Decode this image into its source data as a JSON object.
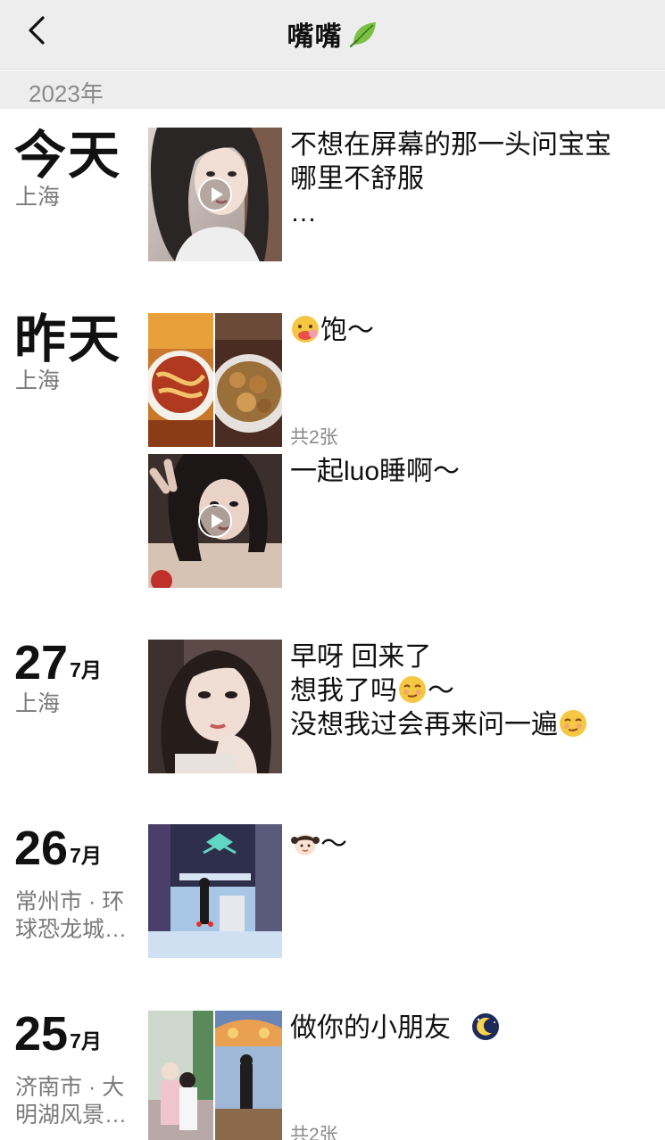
{
  "header": {
    "title": "嘴嘴",
    "title_icon": "leaf-emoji"
  },
  "year": "2023年",
  "entries": [
    {
      "day": "今天",
      "location": "上海",
      "text_lines": [
        "不想在屏幕的那一头问宝宝",
        "哪里不舒服",
        "…"
      ],
      "media": "video"
    },
    {
      "day": "昨天",
      "location": "上海",
      "text": "饱～",
      "text_icon": "face-with-food-emoji",
      "count": "共2张",
      "media": "photos-2",
      "second_text": "一起luo睡啊～",
      "second_media": "video"
    },
    {
      "day": "27",
      "month": "7月",
      "location": "上海",
      "text_lines": [
        "早呀 回来了",
        "想我了吗",
        "没想我过会再来问一遍"
      ],
      "line2_suffix": "～",
      "emoji": "smirk-face-emoji"
    },
    {
      "day": "26",
      "month": "7月",
      "location": "常州市 · 环球恐龙城…",
      "location_lines": [
        "常州市 · 环",
        "球恐龙城…"
      ],
      "text": "～",
      "text_icon": "girl-emoji"
    },
    {
      "day": "25",
      "month": "7月",
      "location_lines": [
        "济南市 · 大",
        "明湖风景…"
      ],
      "text": "做你的小朋友",
      "text_icon": "moon-emoji",
      "count": "共2张",
      "media": "photos-2"
    }
  ],
  "colors": {
    "nav_bg": "#ededed",
    "secondary_text": "#8a8a8a"
  }
}
